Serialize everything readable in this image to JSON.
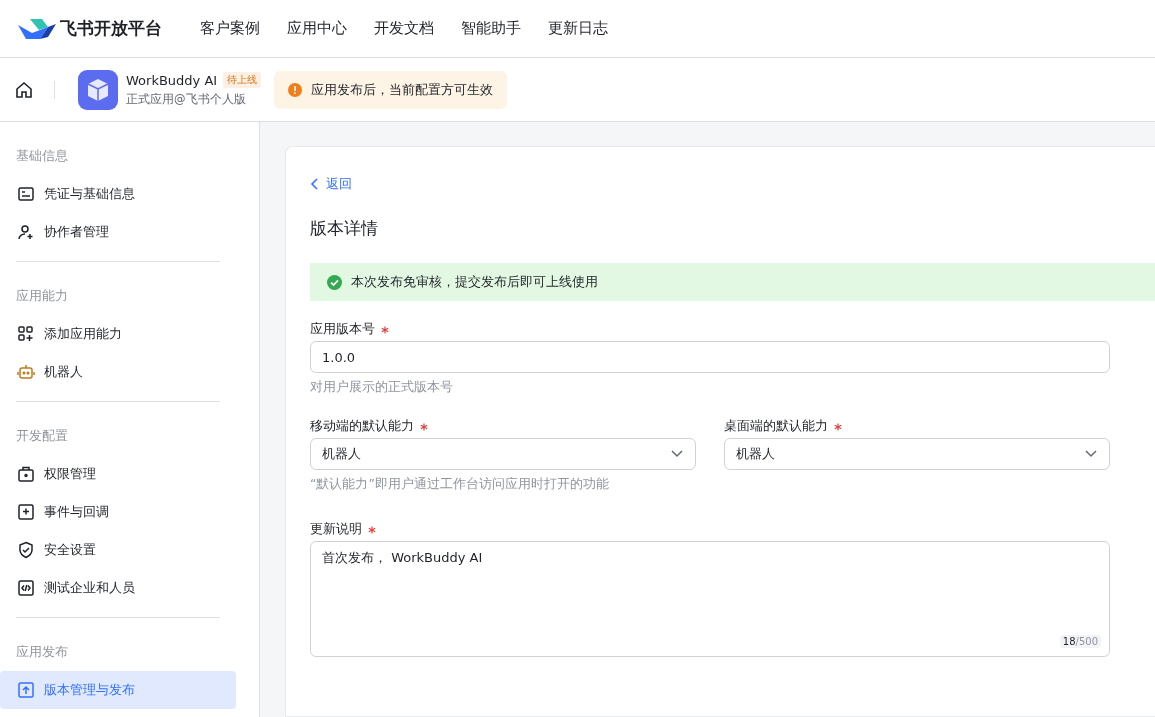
{
  "brand": "飞书开放平台",
  "nav": [
    {
      "label": "客户案例"
    },
    {
      "label": "应用中心"
    },
    {
      "label": "开发文档"
    },
    {
      "label": "智能助手"
    },
    {
      "label": "更新日志"
    }
  ],
  "app": {
    "name": "WorkBuddy AI",
    "status": "待上线",
    "subtitle": "正式应用@飞书个人版",
    "notice": "应用发布后，当前配置方可生效"
  },
  "sidebar": [
    {
      "title": "基础信息",
      "items": [
        {
          "label": "凭证与基础信息",
          "selected": false
        },
        {
          "label": "协作者管理",
          "selected": false
        }
      ]
    },
    {
      "title": "应用能力",
      "items": [
        {
          "label": "添加应用能力",
          "selected": false
        },
        {
          "label": "机器人",
          "selected": false
        }
      ]
    },
    {
      "title": "开发配置",
      "items": [
        {
          "label": "权限管理",
          "selected": false
        },
        {
          "label": "事件与回调",
          "selected": false
        },
        {
          "label": "安全设置",
          "selected": false
        },
        {
          "label": "测试企业和人员",
          "selected": false
        }
      ]
    },
    {
      "title": "应用发布",
      "items": [
        {
          "label": "版本管理与发布",
          "selected": true
        }
      ]
    }
  ],
  "back": "返回",
  "page_title": "版本详情",
  "success_alert": "本次发布免审核，提交发布后即可上线使用",
  "version": {
    "label": "应用版本号",
    "required": true,
    "value": "1.0.0",
    "help": "对用户展示的正式版本号"
  },
  "mobile_default": {
    "label": "移动端的默认能力",
    "required": true,
    "value": "机器人"
  },
  "desktop_default": {
    "label": "桌面端的默认能力",
    "required": true,
    "value": "机器人"
  },
  "default_help": "“默认能力”即用户通过工作台访问应用时打开的功能",
  "notes": {
    "label": "更新说明",
    "required": true,
    "value": "首次发布， WorkBuddy AI",
    "count": "18",
    "limit": "/500"
  }
}
